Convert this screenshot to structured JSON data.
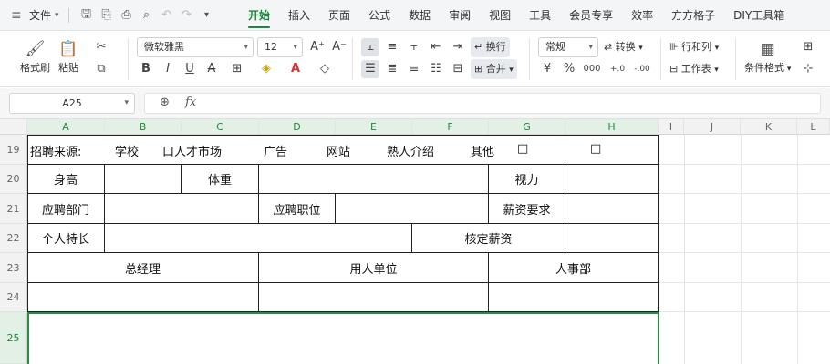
{
  "menubar": {
    "file_label": "文件",
    "tabs": [
      "开始",
      "插入",
      "页面",
      "公式",
      "数据",
      "审阅",
      "视图",
      "工具",
      "会员专享",
      "效率",
      "方方格子",
      "DIY工具箱"
    ],
    "active_tab": "开始"
  },
  "ribbon": {
    "format_painter": "格式刷",
    "paste": "粘贴",
    "font_name": "微软雅黑",
    "font_size": "12",
    "wrap": "换行",
    "merge": "合并",
    "number_format": "常规",
    "convert": "转换",
    "rows_cols": "行和列",
    "worksheet": "工作表",
    "conditional_format": "条件格式",
    "currency_symbol": "¥",
    "percent_symbol": "%",
    "thousands_sep": "000",
    "decimals_increase": "+.0",
    "decimals_decrease": "-.00"
  },
  "formula_bar": {
    "cell_ref": "A25",
    "formula": ""
  },
  "sheet": {
    "columns": [
      "A",
      "B",
      "C",
      "D",
      "E",
      "F",
      "G",
      "H",
      "I",
      "J",
      "K",
      "L"
    ],
    "rows": [
      "19",
      "20",
      "21",
      "22",
      "23",
      "24",
      "25"
    ],
    "r19": {
      "t1": "招聘来源:",
      "t2": "学校",
      "t3": "口人才市场",
      "t4": "广告",
      "t5": "网站",
      "t6": "熟人介绍",
      "t7": "其他",
      "t8": "□",
      "t9": "□"
    },
    "r20": {
      "height": "身高",
      "weight": "体重",
      "vision": "视力"
    },
    "r21": {
      "dept": "应聘部门",
      "position": "应聘职位",
      "salary": "薪资要求"
    },
    "r22": {
      "skill": "个人特长",
      "approved": "核定薪资"
    },
    "r23": {
      "gm": "总经理",
      "unit": "用人单位",
      "hr": "人事部"
    }
  },
  "colors": {
    "accent": "#1a8a3a",
    "selection": "#2a8c3e"
  }
}
